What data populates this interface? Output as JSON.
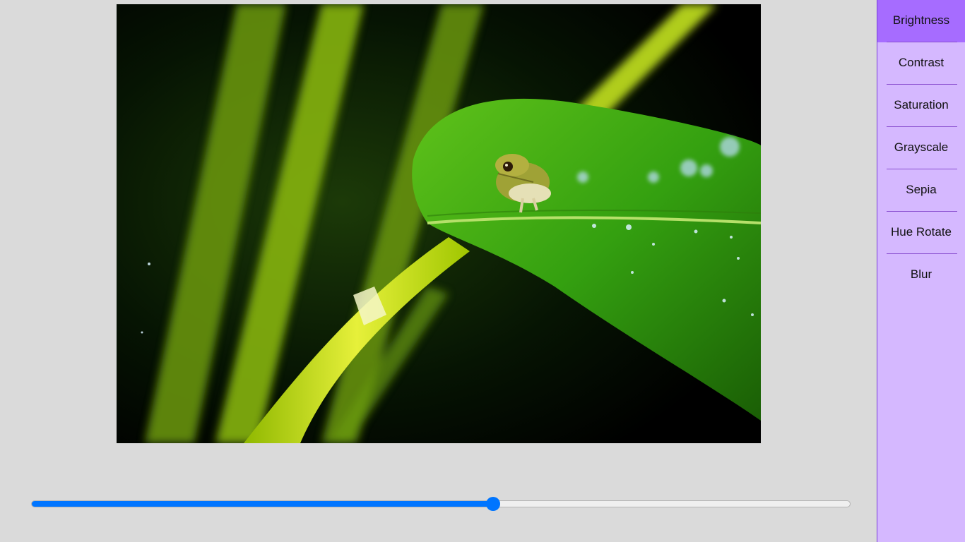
{
  "image": {
    "description_icon": "photo-frog-on-leaf"
  },
  "slider": {
    "value": 0.565,
    "accent_color": "#0075ff"
  },
  "sidebar": {
    "active_color": "#a66cff",
    "background_color": "#d5b8ff",
    "items": [
      {
        "label": "Brightness",
        "active": true
      },
      {
        "label": "Contrast",
        "active": false
      },
      {
        "label": "Saturation",
        "active": false
      },
      {
        "label": "Grayscale",
        "active": false
      },
      {
        "label": "Sepia",
        "active": false
      },
      {
        "label": "Hue Rotate",
        "active": false
      },
      {
        "label": "Blur",
        "active": false
      }
    ]
  }
}
